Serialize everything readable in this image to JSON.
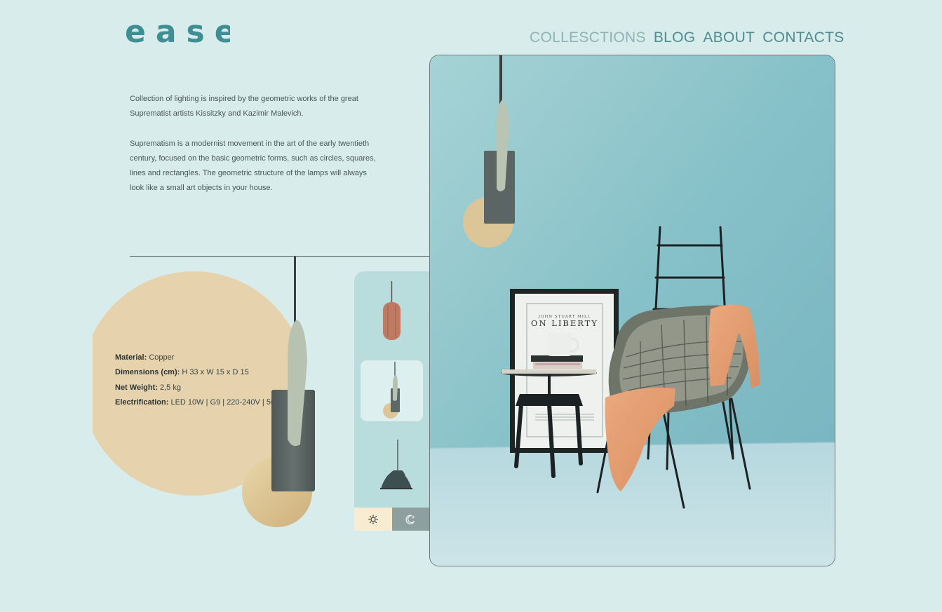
{
  "brand": {
    "logo_text": "ease"
  },
  "nav": [
    {
      "label": "COLLESCTIONS"
    },
    {
      "label": "BLOG"
    },
    {
      "label": "ABOUT"
    },
    {
      "label": "CONTACTS"
    }
  ],
  "intro": {
    "paragraph1": "Collection of lighting is inspired by the geometric works of the great Suprematist artists Kissitzky and Kazimir Malevich.",
    "paragraph2": "Suprematism is a modernist movement in the art of the early twentieth century, focused on the basic geometric forms, such as circles, squares, lines and rectangles. The geometric structure of the lamps will always look like a small art objects in your house."
  },
  "specs": {
    "material_label": "Material:",
    "material_value": "Copper",
    "dimensions_label": "Dimensions (cm):",
    "dimensions_value": "H 33 x W 15 x D 15",
    "weight_label": "Net Weight:",
    "weight_value": "2,5 kg",
    "electrification_label": "Electrification:",
    "electrification_value": "LED 10W | G9 | 220-240V | 50 Hz"
  },
  "poster": {
    "line1": "JOHN STUART MILL",
    "line2": "ON LIBERTY"
  },
  "selector": {
    "thumbnails": [
      {
        "icon": "copper-pendant-lamp-icon",
        "selected": false
      },
      {
        "icon": "geometric-pendant-lamp-icon",
        "selected": true
      },
      {
        "icon": "dome-pendant-lamp-icon",
        "selected": false
      }
    ],
    "modes": [
      {
        "icon": "sun-icon",
        "active": true
      },
      {
        "icon": "moon-icon",
        "active": false
      }
    ]
  },
  "colors": {
    "background": "#d8eceb",
    "brand": "#3f8e93",
    "sand": "#e6d3ad",
    "panel": "#b9dcdc",
    "lamp_body": "#5c6766",
    "wall": "#8cc4cc"
  }
}
